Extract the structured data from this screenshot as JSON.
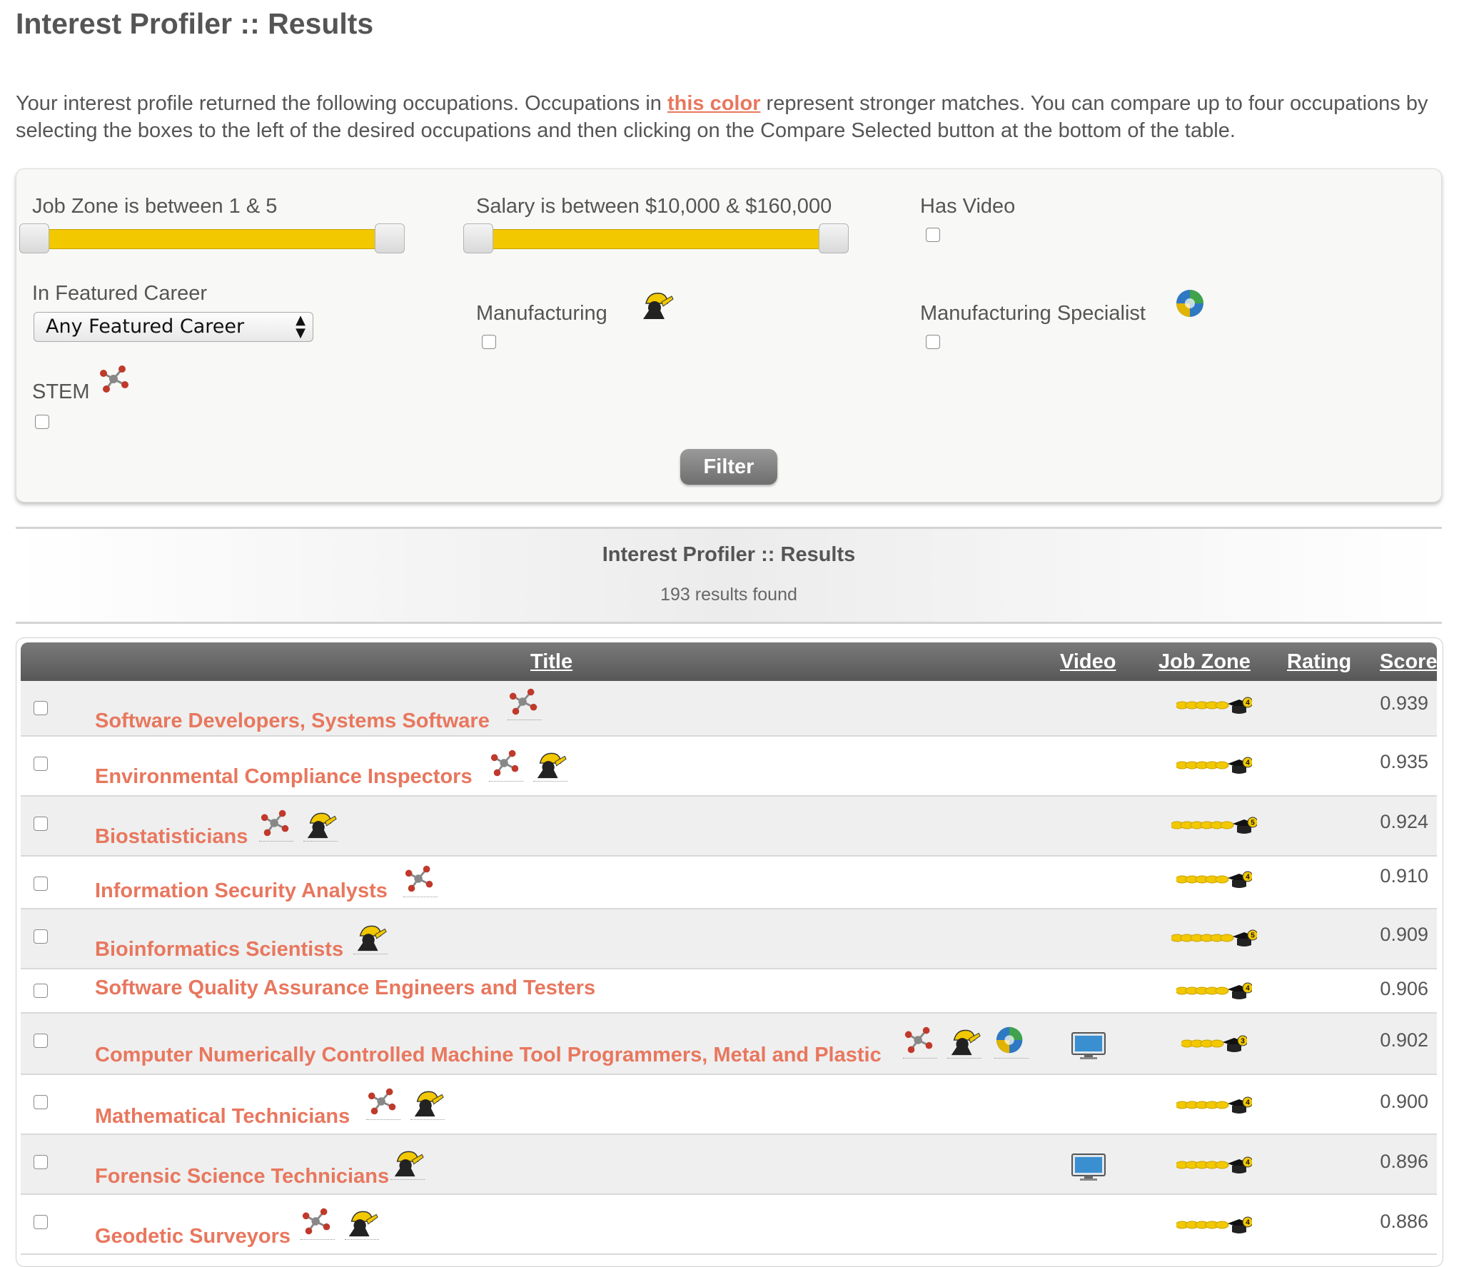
{
  "page": {
    "title": "Interest Profiler :: Results",
    "intro_part1": "Your interest profile returned the following occupations. Occupations in ",
    "intro_highlight": "this color",
    "intro_part2": " represent stronger matches. You can compare up to four occupations by selecting the boxes to the left of the desired occupations and then clicking on the Compare Selected button at the bottom of the table."
  },
  "filters": {
    "job_zone_label": "Job Zone is between 1 & 5",
    "job_zone_range": [
      1,
      5
    ],
    "salary_label": "Salary is between $10,000 & $160,000",
    "salary_range": [
      10000,
      160000
    ],
    "has_video_label": "Has Video",
    "featured_label": "In Featured Career",
    "featured_select": "Any Featured Career",
    "manufacturing_label": "Manufacturing",
    "manufacturing_icon": "hardhat-worker-icon",
    "specialist_label": "Manufacturing Specialist",
    "specialist_icon": "puzzle-globe-icon",
    "stem_label": "STEM",
    "stem_icon": "molecule-icon",
    "filter_button": "Filter"
  },
  "results": {
    "title": "Interest Profiler :: Results",
    "count": "193 results found"
  },
  "table": {
    "headers": {
      "title": "Title",
      "video": "Video",
      "job_zone": "Job Zone",
      "rating": "Rating",
      "score": "Score"
    },
    "rows": [
      {
        "title": "Software Developers, Systems Software",
        "stem": true,
        "manufacturing": false,
        "specialist": false,
        "video": false,
        "job_zone": 4,
        "score": "0.939"
      },
      {
        "title": "Environmental Compliance Inspectors",
        "stem": true,
        "manufacturing": true,
        "specialist": false,
        "video": false,
        "job_zone": 4,
        "score": "0.935"
      },
      {
        "title": "Biostatisticians",
        "stem": true,
        "manufacturing": true,
        "specialist": false,
        "video": false,
        "job_zone": 5,
        "score": "0.924"
      },
      {
        "title": "Information Security Analysts",
        "stem": true,
        "manufacturing": false,
        "specialist": false,
        "video": false,
        "job_zone": 4,
        "score": "0.910"
      },
      {
        "title": "Bioinformatics Scientists",
        "stem": false,
        "manufacturing": true,
        "specialist": false,
        "video": false,
        "job_zone": 5,
        "score": "0.909"
      },
      {
        "title": "Software Quality Assurance Engineers and Testers",
        "stem": false,
        "manufacturing": false,
        "specialist": false,
        "video": false,
        "job_zone": 4,
        "score": "0.906"
      },
      {
        "title": "Computer Numerically Controlled Machine Tool Programmers, Metal and Plastic",
        "stem": true,
        "manufacturing": true,
        "specialist": true,
        "video": true,
        "job_zone": 3,
        "score": "0.902"
      },
      {
        "title": "Mathematical Technicians",
        "stem": true,
        "manufacturing": true,
        "specialist": false,
        "video": false,
        "job_zone": 4,
        "score": "0.900"
      },
      {
        "title": "Forensic Science Technicians",
        "stem": false,
        "manufacturing": true,
        "specialist": false,
        "video": true,
        "job_zone": 4,
        "score": "0.896"
      },
      {
        "title": "Geodetic Surveyors",
        "stem": true,
        "manufacturing": true,
        "specialist": false,
        "video": false,
        "job_zone": 4,
        "score": "0.886"
      }
    ]
  },
  "colors": {
    "match_highlight": "#e8775e",
    "slider_fill": "#f2c800",
    "header_bg": "#666666"
  }
}
